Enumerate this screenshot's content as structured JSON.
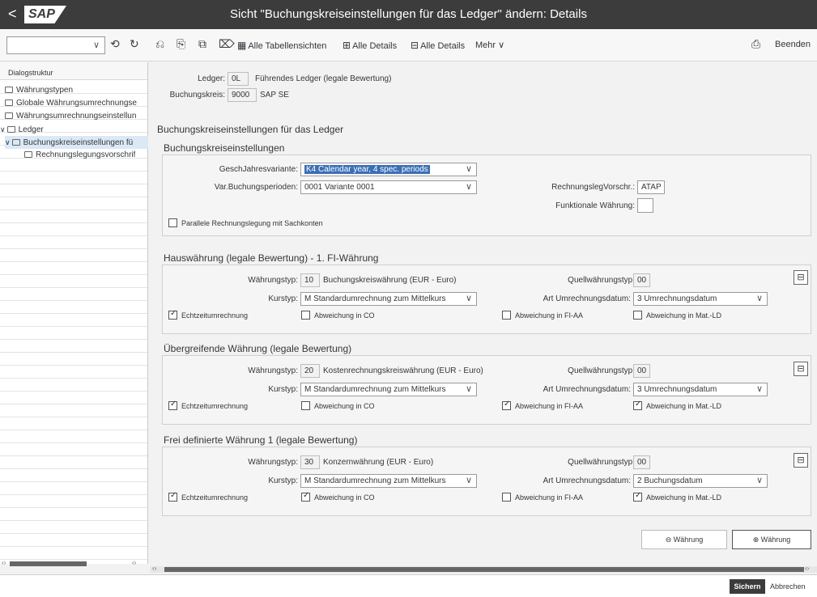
{
  "titlebar": {
    "back_glyph": "<",
    "logo_text": "SAP",
    "title": "Sicht \"Buchungskreiseinstellungen für das Ledger\" ändern: Details"
  },
  "toolbar": {
    "command_field_value": "",
    "btn_alle_tabellensichten": "Alle Tabellensichten",
    "btn_alle_details_1": "Alle Details",
    "btn_alle_details_2": "Alle Details",
    "btn_mehr": "Mehr",
    "btn_beenden": "Beenden"
  },
  "tree": {
    "header": "Dialogstruktur",
    "items": [
      {
        "label": "Währungstypen"
      },
      {
        "label": "Globale Währungsumrechnungse"
      },
      {
        "label": "Währungsumrechnungseinstellun"
      },
      {
        "label": "Ledger"
      },
      {
        "label": "Buchungskreiseinstellungen fü"
      },
      {
        "label": "Rechnungslegungsvorschrif"
      }
    ]
  },
  "header_fields": {
    "ledger_label": "Ledger:",
    "ledger_value": "0L",
    "ledger_desc": "Führendes Ledger (legale Bewertung)",
    "bukrs_label": "Buchungskreis:",
    "bukrs_value": "9000",
    "bukrs_desc": "SAP SE"
  },
  "main_title": "Buchungskreiseinstellungen für das Ledger",
  "settings": {
    "title": "Buchungskreiseinstellungen",
    "gjv_label": "GeschJahresvariante:",
    "gjv_value": "K4 Calendar year, 4 spec. periods",
    "varbuch_label": "Var.Buchungsperioden:",
    "varbuch_value": "0001 Variante 0001",
    "rlv_label": "RechnungslegVorschr.:",
    "rlv_value": "ATAP",
    "funk_label": "Funktionale Währung:",
    "funk_value": "",
    "parallel_label": "Parallele Rechnungslegung mit Sachkonten"
  },
  "currency_sections": [
    {
      "title": "Hauswährung (legale Bewertung) - 1. FI-Währung",
      "wtyp_label": "Währungstyp:",
      "wtyp_value": "10",
      "wtyp_desc": "Buchungskreiswährung (EUR - Euro)",
      "quell_label": "Quellwährungstyp:",
      "quell_value": "00",
      "kurs_label": "Kurstyp:",
      "kurs_value": "M Standardumrechnung zum Mittelkurs",
      "art_label": "Art Umrechnungsdatum:",
      "art_value": "3 Umrechnungsdatum",
      "cb_echtzeit": "Echtzeitumrechnung",
      "cb_co": "Abweichung in CO",
      "cb_fiaa": "Abweichung in FI-AA",
      "cb_matld": "Abweichung in Mat.-LD"
    },
    {
      "title": "Übergreifende Währung (legale Bewertung)",
      "wtyp_label": "Währungstyp:",
      "wtyp_value": "20",
      "wtyp_desc": "Kostenrechnungskreiswährung (EUR - Euro)",
      "quell_label": "Quellwährungstyp:",
      "quell_value": "00",
      "kurs_label": "Kurstyp:",
      "kurs_value": "M Standardumrechnung zum Mittelkurs",
      "art_label": "Art Umrechnungsdatum:",
      "art_value": "3 Umrechnungsdatum",
      "cb_echtzeit": "Echtzeitumrechnung",
      "cb_co": "Abweichung in CO",
      "cb_fiaa": "Abweichung in FI-AA",
      "cb_matld": "Abweichung in Mat.-LD"
    },
    {
      "title": "Frei definierte Währung 1 (legale Bewertung)",
      "wtyp_label": "Währungstyp:",
      "wtyp_value": "30",
      "wtyp_desc": "Konzernwährung (EUR - Euro)",
      "quell_label": "Quellwährungstyp:",
      "quell_value": "00",
      "kurs_label": "Kurstyp:",
      "kurs_value": "M Standardumrechnung zum Mittelkurs",
      "art_label": "Art Umrechnungsdatum:",
      "art_value": "2 Buchungsdatum",
      "cb_echtzeit": "Echtzeitumrechnung",
      "cb_co": "Abweichung in CO",
      "cb_fiaa": "Abweichung in FI-AA",
      "cb_matld": "Abweichung in Mat.-LD"
    }
  ],
  "checks": {
    "parallel": false,
    "s1": {
      "echtzeit": true,
      "co": false,
      "fiaa": false,
      "matld": false
    },
    "s2": {
      "echtzeit": true,
      "co": false,
      "fiaa": true,
      "matld": true
    },
    "s3": {
      "echtzeit": true,
      "co": true,
      "fiaa": false,
      "matld": true
    }
  },
  "buttons": {
    "remove_waehrung": "Währung",
    "add_waehrung": "Währung"
  },
  "footer": {
    "save": "Sichern",
    "cancel": "Abbrechen"
  },
  "colors": {
    "titlebar_bg": "#3c3c3c",
    "selection_bg": "#3b6fb6"
  }
}
